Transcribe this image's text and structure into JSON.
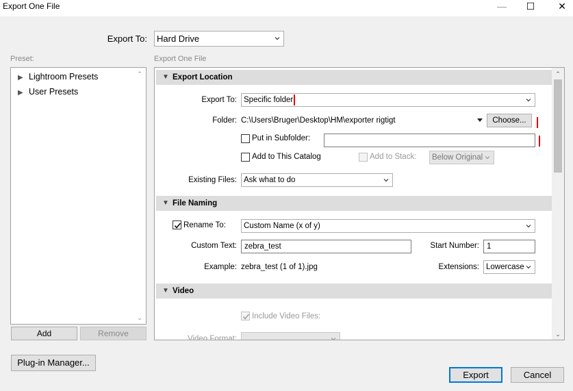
{
  "window": {
    "title": "Export One File",
    "minimize_glyph": "—",
    "maximize_glyph": "☐",
    "close_glyph": "✕"
  },
  "export_to": {
    "label": "Export To:",
    "value": "Hard Drive"
  },
  "preset": {
    "label": "Preset:",
    "items": [
      "Lightroom Presets",
      "User Presets"
    ],
    "add_label": "Add",
    "remove_label": "Remove"
  },
  "main": {
    "panel_label": "Export One File",
    "export_location": {
      "header": "Export Location",
      "export_to_label": "Export To:",
      "export_to_value": "Specific folder",
      "folder_label": "Folder:",
      "folder_path": "C:\\Users\\Bruger\\Desktop\\HM\\exporter rigtigt",
      "choose_label": "Choose...",
      "subfolder_label": "Put in Subfolder:",
      "subfolder_value": "",
      "catalog_label": "Add to This Catalog",
      "stack_label": "Add to Stack:",
      "stack_value": "Below Original",
      "existing_label": "Existing Files:",
      "existing_value": "Ask what to do"
    },
    "file_naming": {
      "header": "File Naming",
      "rename_label": "Rename To:",
      "rename_checked": true,
      "rename_value": "Custom Name (x of y)",
      "custom_text_label": "Custom Text:",
      "custom_text_value": "zebra_test",
      "start_number_label": "Start Number:",
      "start_number_value": "1",
      "example_label": "Example:",
      "example_value": "zebra_test (1 of 1).jpg",
      "extensions_label": "Extensions:",
      "extensions_value": "Lowercase"
    },
    "video": {
      "header": "Video",
      "include_label": "Include Video Files:",
      "include_checked": true,
      "format_label": "Video Format:"
    }
  },
  "footer": {
    "plugin_manager_label": "Plug-in Manager...",
    "export_label": "Export",
    "cancel_label": "Cancel"
  }
}
